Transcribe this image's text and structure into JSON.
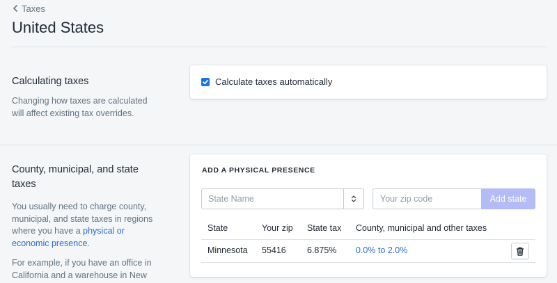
{
  "breadcrumb": {
    "label": "Taxes"
  },
  "page": {
    "title": "United States"
  },
  "calc_section": {
    "title": "Calculating taxes",
    "desc_line1": "Changing how taxes are calculated",
    "desc_line2": "will affect existing tax overrides.",
    "checkbox_label": "Calculate taxes automatically",
    "checkbox_checked": true
  },
  "county_section": {
    "title_line1": "County, municipal, and state",
    "title_line2": "taxes",
    "desc_line1": "You usually need to charge county,",
    "desc_line2": "municipal, and state taxes in regions",
    "desc_line3_prefix": "where you have a ",
    "desc_link_part1": "physical or",
    "desc_link_part2": "economic presence",
    "desc_line4_suffix": ".",
    "desc2_line1": "For example, if you have an office in",
    "desc2_line2": "California and a warehouse in New"
  },
  "presence_card": {
    "heading": "ADD A PHYSICAL PRESENCE",
    "state_placeholder": "State Name",
    "zip_placeholder": "Your zip code",
    "add_button": "Add state",
    "columns": [
      "State",
      "Your zip",
      "State tax",
      "County, municipal and other taxes"
    ],
    "rows": [
      {
        "state": "Minnesota",
        "zip": "55416",
        "state_tax": "6.875%",
        "other_taxes": "0.0% to 2.0%"
      }
    ]
  },
  "colors": {
    "link": "#2c6ecb",
    "accent": "#1a73e8",
    "button_disabled": "#b3bcf5"
  }
}
